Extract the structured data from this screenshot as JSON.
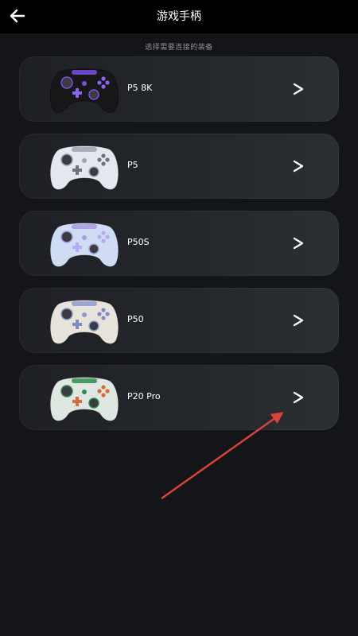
{
  "header": {
    "title": "游戏手柄",
    "back_icon": "arrow-left-icon"
  },
  "subtitle": "选择需要连接的装备",
  "devices": [
    {
      "name": "P5 8K",
      "body_color": "#17171a",
      "accent_color": "#7b4fe0",
      "button_color": "#8a63f2"
    },
    {
      "name": "P5",
      "body_color": "#e6e8ef",
      "accent_color": "#9ea3b2",
      "button_color": "#6d7180"
    },
    {
      "name": "P50S",
      "body_color": "#cfdcf4",
      "accent_color": "#a99be0",
      "button_color": "#b8a9f0"
    },
    {
      "name": "P50",
      "body_color": "#e8e4dc",
      "accent_color": "#8e9bd0",
      "button_color": "#7f8cc4"
    },
    {
      "name": "P20 Pro",
      "body_color": "#dfe7e2",
      "accent_color": "#2f8a4f",
      "button_color": "#d96b3a"
    }
  ],
  "chevron_icon": "chevron-right-icon",
  "annotation_color": "#d9433a"
}
